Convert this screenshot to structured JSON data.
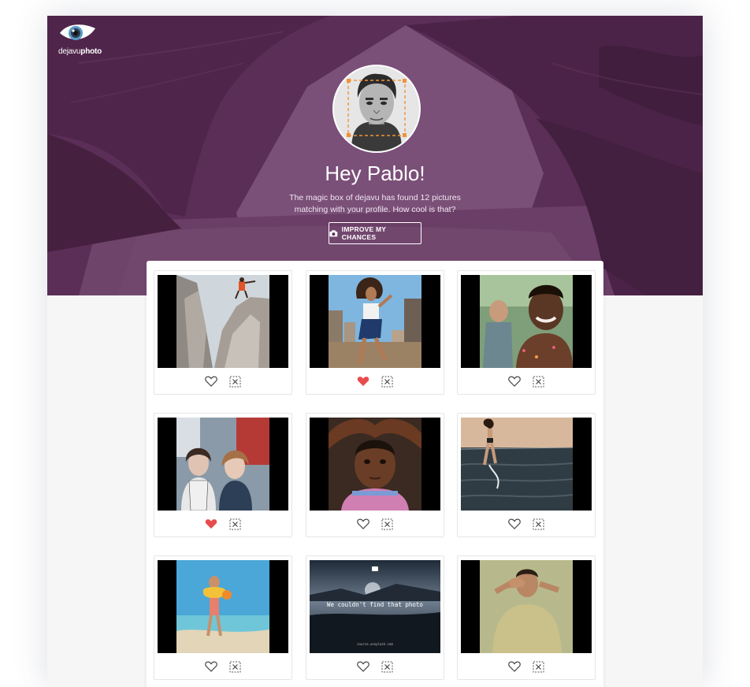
{
  "brand": {
    "logo_part1": "dejavu",
    "logo_part2": "photo"
  },
  "hero": {
    "title": "Hey Pablo!",
    "subtitle_line1": "The magic box of dejavu has found 12 pictures",
    "subtitle_line2": "matching with your profile. How cool is that?",
    "cta_label": "IMPROVE MY CHANCES"
  },
  "colors": {
    "hero_overlay": "#5d2f59",
    "heart_active": "#e84b4b",
    "face_box": "#f0923a"
  },
  "photos": [
    {
      "subject": "climber on rock",
      "liked": false
    },
    {
      "subject": "woman in city",
      "liked": true
    },
    {
      "subject": "smiling boy",
      "liked": false
    },
    {
      "subject": "two girls",
      "liked": true
    },
    {
      "subject": "child portrait",
      "liked": false
    },
    {
      "subject": "woman at sea",
      "liked": false
    },
    {
      "subject": "child on beach",
      "liked": false
    },
    {
      "subject": "missing photo",
      "liked": false,
      "error_text": "We couldn't find that photo",
      "error_source": "source.unsplash.com"
    },
    {
      "subject": "man covering eyes",
      "liked": false
    }
  ]
}
